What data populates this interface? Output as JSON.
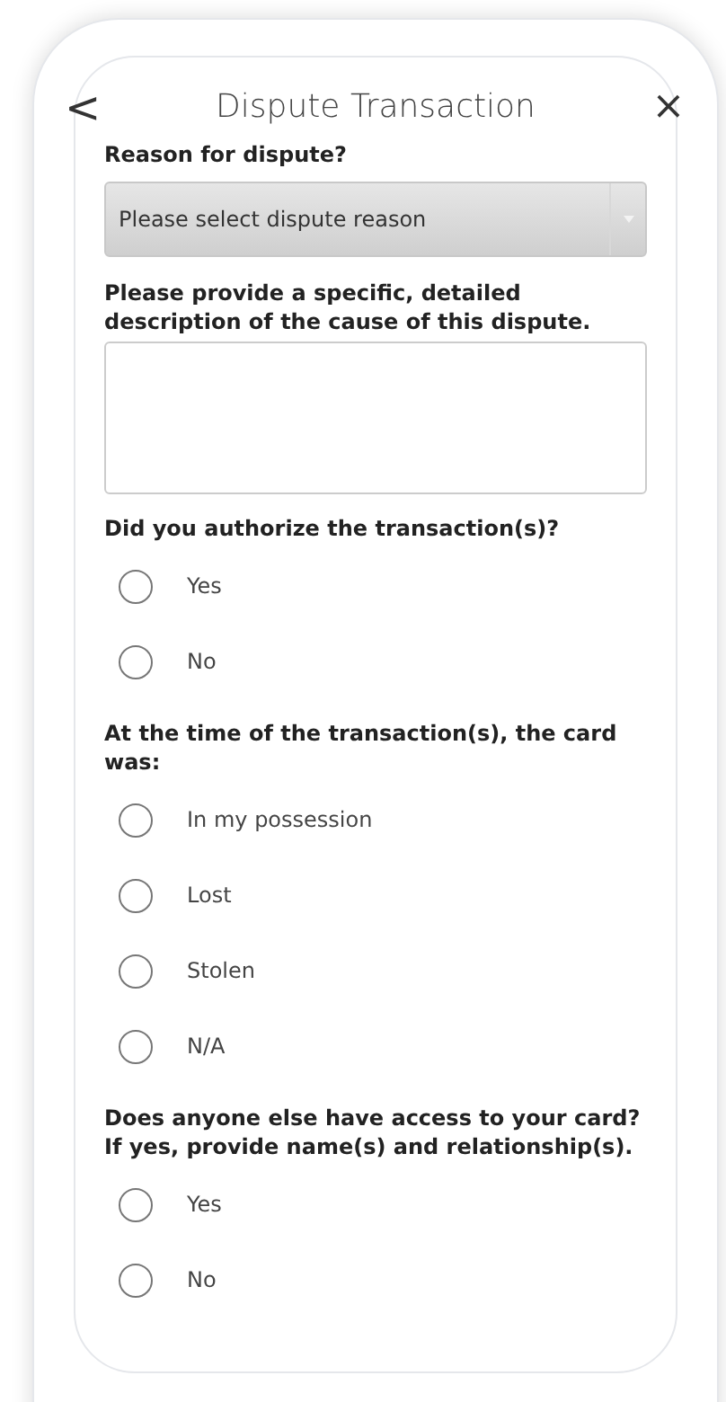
{
  "header": {
    "back": "<",
    "title": "Dispute Transaction",
    "close": "×"
  },
  "reason": {
    "label": "Reason for dispute?",
    "placeholder": "Please select dispute reason"
  },
  "description": {
    "label": "Please provide a specific, detailed description of the cause of this dispute."
  },
  "questions": [
    {
      "label": "Did you authorize the transaction(s)?",
      "options": [
        {
          "label": "Yes",
          "selected": false
        },
        {
          "label": "No",
          "selected": false
        }
      ]
    },
    {
      "label": "At the time of the transaction(s), the card was:",
      "options": [
        {
          "label": "In my possession",
          "selected": false
        },
        {
          "label": "Lost",
          "selected": false
        },
        {
          "label": "Stolen",
          "selected": false
        },
        {
          "label": "N/A",
          "selected": false
        }
      ]
    },
    {
      "label": "Does anyone else have access to your card? If yes, provide name(s) and relationship(s).",
      "options": [
        {
          "label": "Yes",
          "selected": false
        },
        {
          "label": "No",
          "selected": false
        }
      ]
    }
  ]
}
